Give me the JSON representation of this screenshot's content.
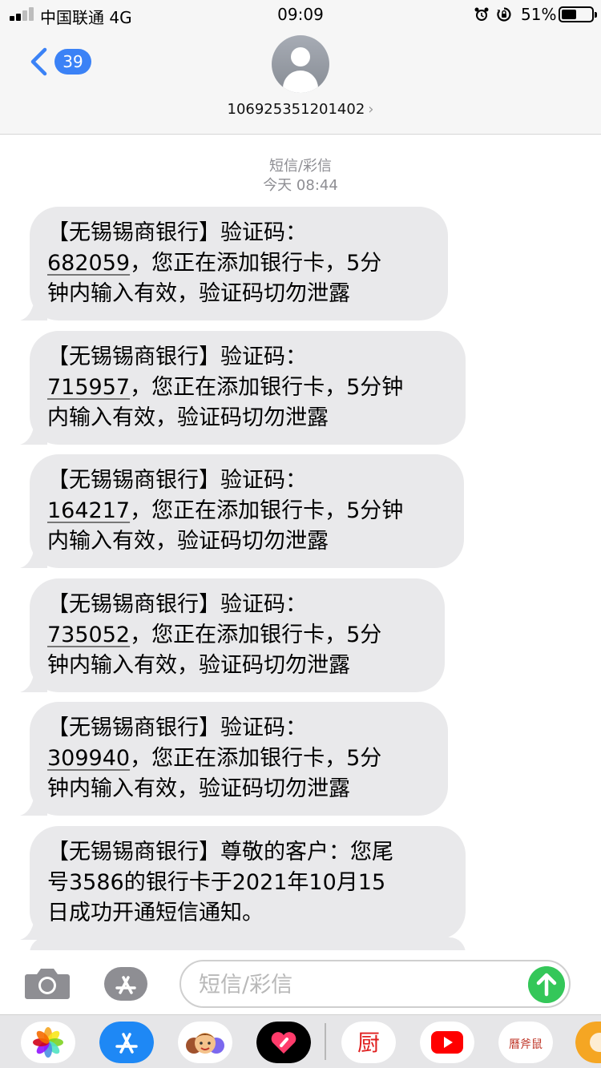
{
  "status_bar": {
    "carrier": "中国联通 4G",
    "time": "09:09",
    "battery_percent": "51%",
    "battery_level": 0.51,
    "signal_bars_active": 2
  },
  "header": {
    "back_count": "39",
    "contact_number": "106925351201402",
    "accent_color": "#3b82f6"
  },
  "thread": {
    "message_type": "短信/彩信",
    "timestamp": "今天 08:44"
  },
  "messages": [
    {
      "lines": [
        "【无锡锡商银行】验证码：",
        "{code}，您正在添加银行卡，5分",
        "钟内输入有效，验证码切勿泄露"
      ],
      "code": "682059"
    },
    {
      "lines": [
        "【无锡锡商银行】验证码：",
        "{code}，您正在添加银行卡，5分钟",
        "内输入有效，验证码切勿泄露"
      ],
      "code": "715957"
    },
    {
      "lines": [
        "【无锡锡商银行】验证码：",
        "{code}，您正在添加银行卡，5分钟",
        "内输入有效，验证码切勿泄露"
      ],
      "code": "164217"
    },
    {
      "lines": [
        "【无锡锡商银行】验证码：",
        "{code}，您正在添加银行卡，5分",
        "钟内输入有效，验证码切勿泄露"
      ],
      "code": "735052"
    },
    {
      "lines": [
        "【无锡锡商银行】验证码：",
        "{code}，您正在添加银行卡，5分",
        "钟内输入有效，验证码切勿泄露"
      ],
      "code": "309940"
    },
    {
      "lines": [
        "【无锡锡商银行】尊敬的客户：您尾",
        "号3586的银行卡于2021年10月15",
        "日成功开通短信通知。"
      ],
      "code": ""
    }
  ],
  "composer": {
    "placeholder": "短信/彩信",
    "value": "",
    "send_color": "#34c759"
  },
  "app_drawer": {
    "apps": [
      {
        "name": "photos-icon"
      },
      {
        "name": "app-store-icon"
      },
      {
        "name": "memoji-icon"
      },
      {
        "name": "digital-touch-icon"
      },
      {
        "name": "chu-app-icon",
        "glyph": "厨"
      },
      {
        "name": "youtube-icon"
      },
      {
        "name": "stamp-app-icon",
        "glyph": "曆斧鼠"
      },
      {
        "name": "partial-app-icon"
      }
    ]
  }
}
